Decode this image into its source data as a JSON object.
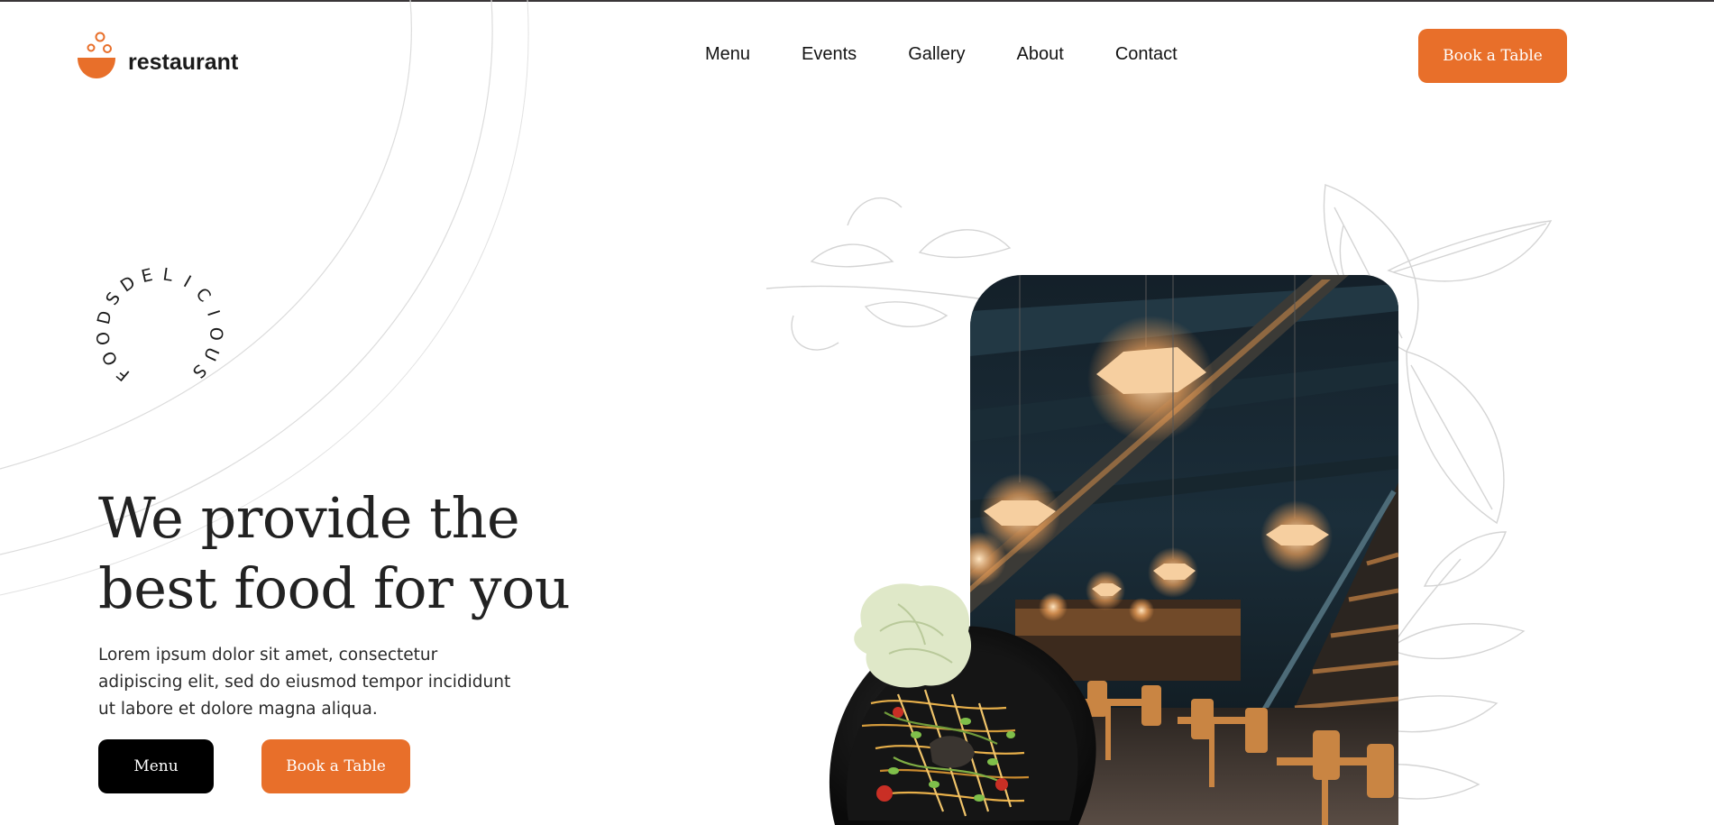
{
  "header": {
    "logo_text": "restaurant",
    "nav": [
      "Menu",
      "Events",
      "Gallery",
      "About",
      "Contact"
    ],
    "cta_label": "Book a Table"
  },
  "badge": {
    "circle_text": "FOODSDELICIOUS"
  },
  "hero": {
    "title_line1": "We provide the",
    "title_line2": "best food for you",
    "description": "Lorem ipsum dolor sit amet, consectetur adipiscing elit, sed do eiusmod tempor incididunt ut labore et dolore magna aliqua.",
    "menu_button": "Menu",
    "book_button": "Book a Table"
  },
  "colors": {
    "accent": "#e86f2a",
    "dark": "#000000",
    "text": "#222222"
  },
  "icons": {
    "logo": "bowl-bubbles-icon"
  }
}
